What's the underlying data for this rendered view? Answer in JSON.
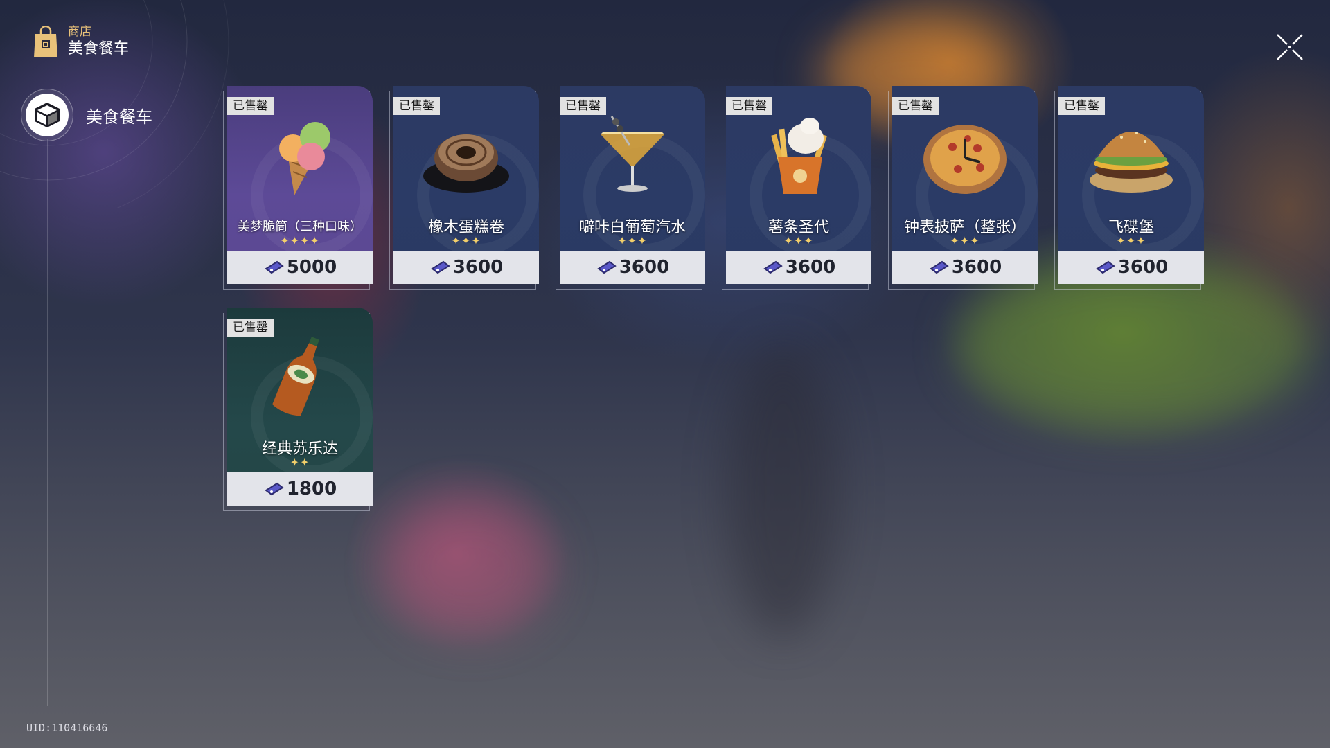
{
  "header": {
    "category": "商店",
    "title": "美食餐车"
  },
  "sidebar": {
    "items": [
      {
        "label": "美食餐车",
        "icon": "cube-icon",
        "selected": true
      }
    ]
  },
  "uid": "UID:110416646",
  "colors": {
    "star": "#f3cf6a",
    "badge_bg": "#e2e2e2",
    "price_bar": "#e3e4ea"
  },
  "items": [
    {
      "name": "美梦脆筒（三种口味）",
      "stars": "✦✦✦✦",
      "rating": 4,
      "price": "5000",
      "badge": "已售罄",
      "icon": "ice-cream-cone-icon",
      "theme": "purple"
    },
    {
      "name": "橡木蛋糕卷",
      "stars": "✦✦✦",
      "rating": 3,
      "price": "3600",
      "badge": "已售罄",
      "icon": "cake-roll-icon",
      "theme": "blue"
    },
    {
      "name": "噼咔白葡萄汽水",
      "stars": "✦✦✦",
      "rating": 3,
      "price": "3600",
      "badge": "已售罄",
      "icon": "cocktail-glass-icon",
      "theme": "blue"
    },
    {
      "name": "薯条圣代",
      "stars": "✦✦✦",
      "rating": 3,
      "price": "3600",
      "badge": "已售罄",
      "icon": "fries-sundae-icon",
      "theme": "blue"
    },
    {
      "name": "钟表披萨（整张）",
      "stars": "✦✦✦",
      "rating": 3,
      "price": "3600",
      "badge": "已售罄",
      "icon": "pizza-icon",
      "theme": "blue"
    },
    {
      "name": "飞碟堡",
      "stars": "✦✦✦",
      "rating": 3,
      "price": "3600",
      "badge": "已售罄",
      "icon": "burger-icon",
      "theme": "blue"
    },
    {
      "name": "经典苏乐达",
      "stars": "✦✦",
      "rating": 2,
      "price": "1800",
      "badge": "已售罄",
      "icon": "soda-bottle-icon",
      "theme": "teal"
    }
  ]
}
